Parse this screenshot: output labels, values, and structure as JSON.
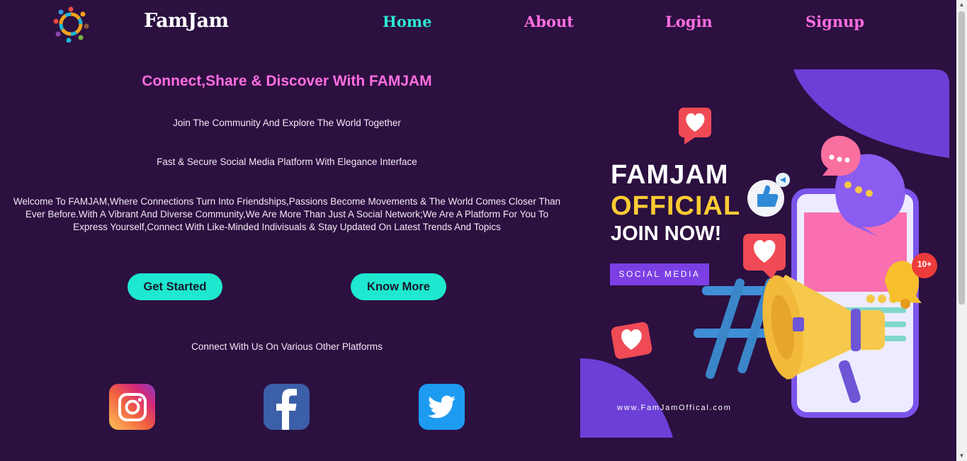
{
  "brand": {
    "name": "FamJam",
    "logo": "people-circle-logo"
  },
  "nav": {
    "home": "Home",
    "about": "About",
    "login": "Login",
    "signup": "Signup",
    "active_color": "#2ee6d6",
    "link_color": "#ff6ee0"
  },
  "hero": {
    "headline": "Connect,Share & Discover With FAMJAM",
    "tagline_1": "Join The Community And Explore The World Together",
    "tagline_2": "Fast & Secure Social Media Platform With Elegance Interface",
    "welcome_line_1": "Welcome To FAMJAM,Where Connections Turn Into Friendships,Passions Become Movements & The World Comes Closer Than",
    "welcome_line_2": "Ever Before.With A Vibrant And Diverse Community,We Are More Than Just A Social Network;We Are A Platform For You To",
    "welcome_line_3": "Express Yourself,Connect With Like-Minded Indivisuals & Stay Updated On Latest Trends And Topics",
    "get_started": "Get Started",
    "know_more": "Know More",
    "connect_text": "Connect With Us On Various Other Platforms",
    "button_color": "#1ee8cf"
  },
  "social": {
    "instagram": "instagram-icon",
    "facebook": "facebook-icon",
    "twitter": "twitter-icon"
  },
  "poster": {
    "line_1": "FAMJAM",
    "line_2": "OFFICIAL",
    "line_3": "JOIN NOW!",
    "badge": "SOCIAL MEDIA",
    "notification": "10+",
    "website": "www.FamJamOffical.com",
    "accent_yellow": "#ffcc33",
    "accent_purple": "#7b3fe4"
  }
}
